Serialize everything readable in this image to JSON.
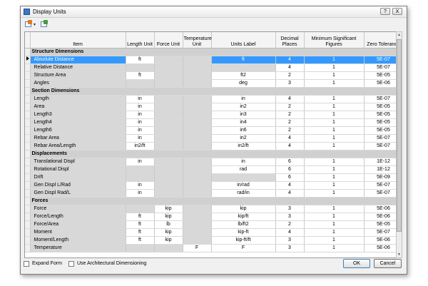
{
  "window": {
    "title": "Display Units",
    "help_label": "?",
    "close_label": "X"
  },
  "toolbar": {
    "icons": [
      "export-icon",
      "import-icon"
    ]
  },
  "columns": [
    "Item",
    "Length Unit",
    "Force Unit",
    "Temperature Unit",
    "Units Label",
    "Decimal Places",
    "Minimum Significant Figures",
    "Zero Tolerance"
  ],
  "rows": [
    {
      "type": "section",
      "label": "Structure Dimensions"
    },
    {
      "type": "row",
      "item": "Absolute Distance",
      "length": "ft",
      "force": "",
      "temp": "",
      "label": "ft",
      "dec": "4",
      "min": "1",
      "zero": "5E-07",
      "selected": true
    },
    {
      "type": "row",
      "item": "Relative Distance",
      "length": "",
      "force": "",
      "temp": "",
      "label": "",
      "dec": "4",
      "min": "1",
      "zero": "5E-07"
    },
    {
      "type": "row",
      "item": "Structure Area",
      "length": "ft",
      "force": "",
      "temp": "",
      "label": "ft2",
      "dec": "2",
      "min": "1",
      "zero": "5E-05"
    },
    {
      "type": "row",
      "item": "Angles",
      "length": "",
      "force": "",
      "temp": "",
      "label": "deg",
      "dec": "3",
      "min": "1",
      "zero": "5E-06"
    },
    {
      "type": "section",
      "label": "Section Dimensions"
    },
    {
      "type": "row",
      "item": "Length",
      "length": "in",
      "force": "",
      "temp": "",
      "label": "in",
      "dec": "4",
      "min": "1",
      "zero": "5E-07"
    },
    {
      "type": "row",
      "item": "Area",
      "length": "in",
      "force": "",
      "temp": "",
      "label": "in2",
      "dec": "2",
      "min": "1",
      "zero": "5E-05"
    },
    {
      "type": "row",
      "item": "Length3",
      "length": "in",
      "force": "",
      "temp": "",
      "label": "in3",
      "dec": "2",
      "min": "1",
      "zero": "5E-05"
    },
    {
      "type": "row",
      "item": "Length4",
      "length": "in",
      "force": "",
      "temp": "",
      "label": "in4",
      "dec": "2",
      "min": "1",
      "zero": "5E-05"
    },
    {
      "type": "row",
      "item": "Length6",
      "length": "in",
      "force": "",
      "temp": "",
      "label": "in6",
      "dec": "2",
      "min": "1",
      "zero": "5E-05"
    },
    {
      "type": "row",
      "item": "Rebar Area",
      "length": "in",
      "force": "",
      "temp": "",
      "label": "in2",
      "dec": "4",
      "min": "1",
      "zero": "5E-07"
    },
    {
      "type": "row",
      "item": "Rebar Area/Length",
      "length": "in2/ft",
      "force": "",
      "temp": "",
      "label": "in2/ft",
      "dec": "4",
      "min": "1",
      "zero": "5E-07"
    },
    {
      "type": "section",
      "label": "Displacements"
    },
    {
      "type": "row",
      "item": "Translational Displ",
      "length": "in",
      "force": "",
      "temp": "",
      "label": "in",
      "dec": "6",
      "min": "1",
      "zero": "1E-12"
    },
    {
      "type": "row",
      "item": "Rotational Displ",
      "length": "",
      "force": "",
      "temp": "",
      "label": "rad",
      "dec": "6",
      "min": "1",
      "zero": "1E-12"
    },
    {
      "type": "row",
      "item": "Drift",
      "length": "",
      "force": "",
      "temp": "",
      "label": "",
      "dec": "6",
      "min": "1",
      "zero": "5E-09"
    },
    {
      "type": "row",
      "item": "Gen Displ L/Rad",
      "length": "in",
      "force": "",
      "temp": "",
      "label": "in/rad",
      "dec": "4",
      "min": "1",
      "zero": "5E-07"
    },
    {
      "type": "row",
      "item": "Gen Displ Rad/L",
      "length": "in",
      "force": "",
      "temp": "",
      "label": "rad/in",
      "dec": "4",
      "min": "1",
      "zero": "5E-07"
    },
    {
      "type": "section",
      "label": "Forces"
    },
    {
      "type": "row",
      "item": "Force",
      "length": "",
      "force": "kip",
      "temp": "",
      "label": "kip",
      "dec": "3",
      "min": "1",
      "zero": "5E-06"
    },
    {
      "type": "row",
      "item": "Force/Length",
      "length": "ft",
      "force": "kip",
      "temp": "",
      "label": "kip/ft",
      "dec": "3",
      "min": "1",
      "zero": "5E-06"
    },
    {
      "type": "row",
      "item": "Force/Area",
      "length": "ft",
      "force": "lb",
      "temp": "",
      "label": "lb/ft2",
      "dec": "2",
      "min": "1",
      "zero": "5E-05"
    },
    {
      "type": "row",
      "item": "Moment",
      "length": "ft",
      "force": "kip",
      "temp": "",
      "label": "kip-ft",
      "dec": "4",
      "min": "1",
      "zero": "5E-07"
    },
    {
      "type": "row",
      "item": "Moment/Length",
      "length": "ft",
      "force": "kip",
      "temp": "",
      "label": "kip-ft/ft",
      "dec": "3",
      "min": "1",
      "zero": "5E-06"
    },
    {
      "type": "row",
      "item": "Temperature",
      "length": "",
      "force": "",
      "temp": "F",
      "label": "F",
      "dec": "3",
      "min": "1",
      "zero": "5E-06"
    }
  ],
  "footer": {
    "expand_form": "Expand Form",
    "architectural": "Use Architectural Dimensioning",
    "ok": "OK",
    "cancel": "Cancel"
  },
  "scroll": {
    "up": "▲",
    "down": "▼"
  }
}
